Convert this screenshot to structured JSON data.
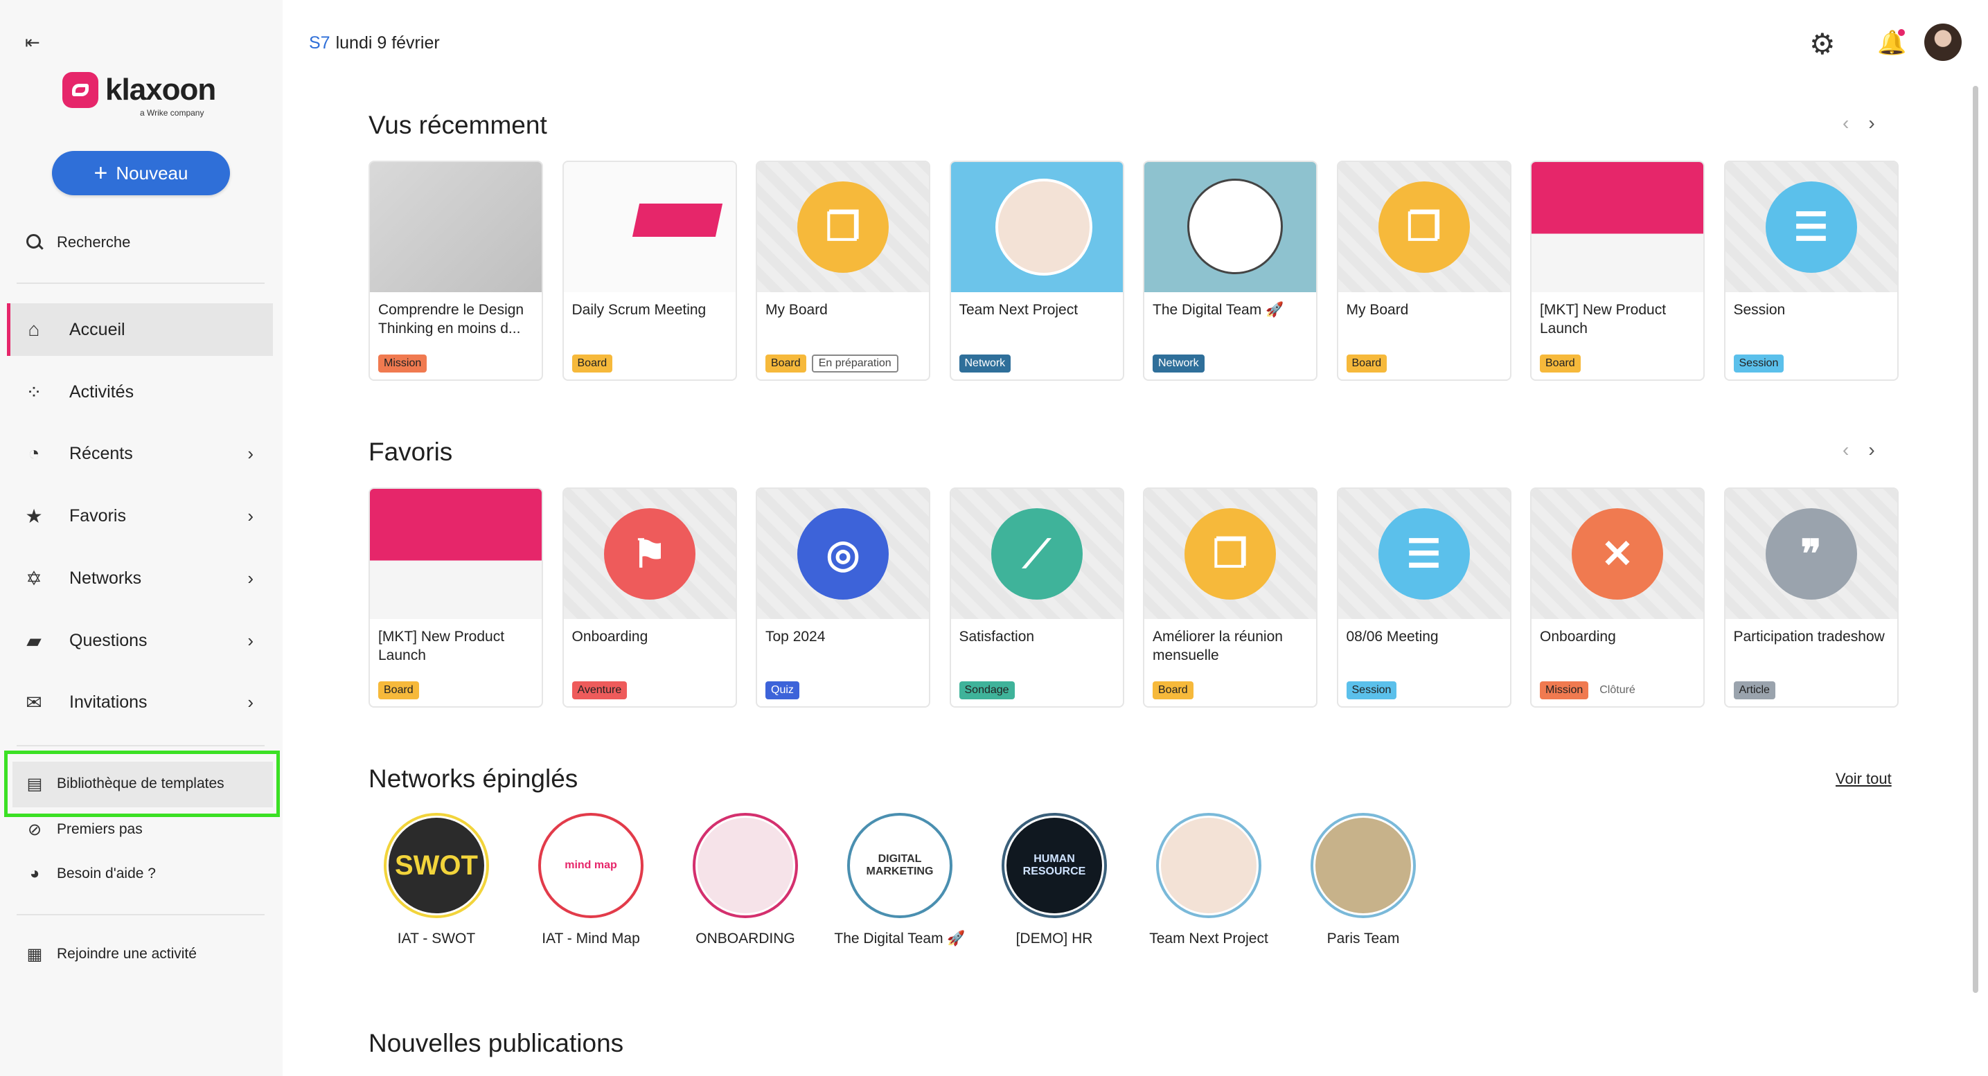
{
  "sidebar": {
    "logo_text": "klaxoon",
    "logo_sub": "a Wrike company",
    "new_button": "Nouveau",
    "search_label": "Recherche",
    "nav": [
      {
        "label": "Accueil",
        "icon": "home-icon"
      },
      {
        "label": "Activités",
        "icon": "grid-icon"
      },
      {
        "label": "Récents",
        "icon": "clock-icon"
      },
      {
        "label": "Favoris",
        "icon": "star-icon"
      },
      {
        "label": "Networks",
        "icon": "network-icon"
      },
      {
        "label": "Questions",
        "icon": "questions-icon"
      },
      {
        "label": "Invitations",
        "icon": "mail-icon"
      }
    ],
    "templates": "Bibliothèque de templates",
    "first_steps": "Premiers pas",
    "help": "Besoin d'aide ?",
    "join": "Rejoindre une activité"
  },
  "header": {
    "week": "S7",
    "date": "lundi 9 février"
  },
  "recent": {
    "title": "Vus récemment",
    "items": [
      {
        "title": "Comprendre le Design Thinking en moins d...",
        "badges": [
          "Mission"
        ],
        "thumb": "image-creativity"
      },
      {
        "title": "Daily Scrum Meeting",
        "badges": [
          "Board"
        ],
        "thumb": "image-daily-scrum"
      },
      {
        "title": "My Board",
        "badges": [
          "Board",
          "En préparation"
        ],
        "thumb": "board-icon"
      },
      {
        "title": "Team Next Project",
        "badges": [
          "Network"
        ],
        "thumb": "image-team"
      },
      {
        "title": "The Digital Team 🚀",
        "badges": [
          "Network"
        ],
        "thumb": "image-digital-marketing"
      },
      {
        "title": "My Board",
        "badges": [
          "Board"
        ],
        "thumb": "board-icon"
      },
      {
        "title": "[MKT] New Product Launch",
        "badges": [
          "Board"
        ],
        "thumb": "image-product-launch"
      },
      {
        "title": "Session",
        "badges": [
          "Session"
        ],
        "thumb": "session-icon"
      }
    ]
  },
  "favorites": {
    "title": "Favoris",
    "items": [
      {
        "title": "[MKT] New Product Launch",
        "badges": [
          "Board"
        ]
      },
      {
        "title": "Onboarding",
        "badges": [
          "Aventure"
        ]
      },
      {
        "title": "Top 2024",
        "badges": [
          "Quiz"
        ]
      },
      {
        "title": "Satisfaction",
        "badges": [
          "Sondage"
        ]
      },
      {
        "title": "Améliorer la réunion mensuelle",
        "badges": [
          "Board"
        ]
      },
      {
        "title": "08/06 Meeting",
        "badges": [
          "Session"
        ]
      },
      {
        "title": "Onboarding",
        "badges": [
          "Mission",
          "Clôturé"
        ]
      },
      {
        "title": "Participation tradeshow",
        "badges": [
          "Article"
        ]
      }
    ]
  },
  "networks": {
    "title": "Networks épinglés",
    "see_all": "Voir tout",
    "items": [
      {
        "name": "IAT - SWOT",
        "logo": "SWOT"
      },
      {
        "name": "IAT - Mind Map",
        "logo": "mind map"
      },
      {
        "name": "ONBOARDING",
        "logo": ""
      },
      {
        "name": "The Digital Team 🚀",
        "logo": "DIGITAL MARKETING"
      },
      {
        "name": "[DEMO] HR",
        "logo": "HUMAN RESOURCE"
      },
      {
        "name": "Team Next Project",
        "logo": ""
      },
      {
        "name": "Paris Team",
        "logo": ""
      }
    ]
  },
  "publications": {
    "title": "Nouvelles publications"
  },
  "colors": {
    "accent": "#e6266a",
    "primary": "#2f6fd8",
    "board": "#f6b93b",
    "mission": "#f07a50",
    "network": "#2f6f9a",
    "session": "#5bc0eb",
    "aventure": "#ee5b5b",
    "quiz": "#3d63d9",
    "sondage": "#3fb39a",
    "article": "#9aa3ad",
    "highlight": "#3be024"
  }
}
